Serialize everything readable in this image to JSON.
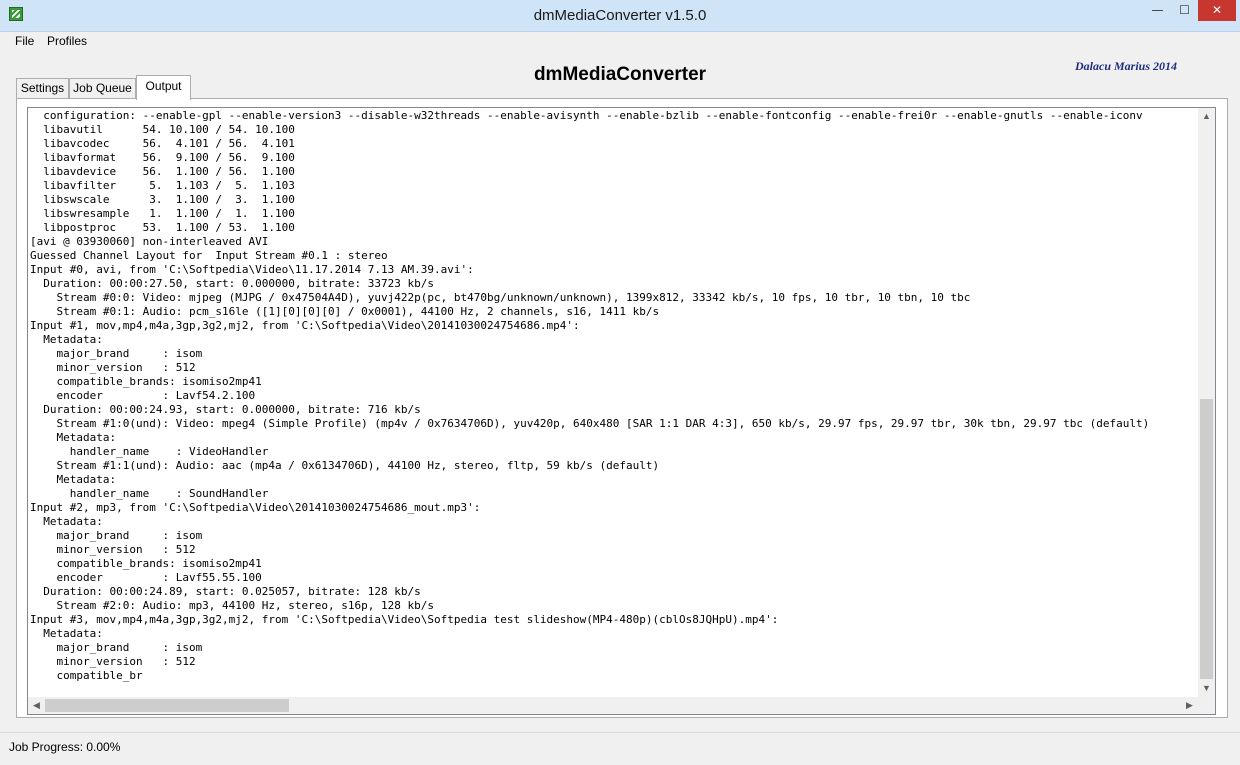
{
  "window": {
    "title": "dmMediaConverter v1.5.0",
    "minimize": "—",
    "maximize": "☐",
    "close": "✕"
  },
  "menu": {
    "file": "File",
    "profiles": "Profiles"
  },
  "header": {
    "app_name": "dmMediaConverter",
    "author": "Dalacu Marius 2014"
  },
  "tabs": {
    "settings": "Settings",
    "job_queue": "Job Queue",
    "output": "Output",
    "active": "Output"
  },
  "output_log": {
    "lines": [
      "  configuration: --enable-gpl --enable-version3 --disable-w32threads --enable-avisynth --enable-bzlib --enable-fontconfig --enable-frei0r --enable-gnutls --enable-iconv",
      "  libavutil      54. 10.100 / 54. 10.100",
      "  libavcodec     56.  4.101 / 56.  4.101",
      "  libavformat    56.  9.100 / 56.  9.100",
      "  libavdevice    56.  1.100 / 56.  1.100",
      "  libavfilter     5.  1.103 /  5.  1.103",
      "  libswscale      3.  1.100 /  3.  1.100",
      "  libswresample   1.  1.100 /  1.  1.100",
      "  libpostproc    53.  1.100 / 53.  1.100",
      "[avi @ 03930060] non-interleaved AVI",
      "Guessed Channel Layout for  Input Stream #0.1 : stereo",
      "Input #0, avi, from 'C:\\Softpedia\\Video\\11.17.2014 7.13 AM.39.avi':",
      "  Duration: 00:00:27.50, start: 0.000000, bitrate: 33723 kb/s",
      "    Stream #0:0: Video: mjpeg (MJPG / 0x47504A4D), yuvj422p(pc, bt470bg/unknown/unknown), 1399x812, 33342 kb/s, 10 fps, 10 tbr, 10 tbn, 10 tbc",
      "    Stream #0:1: Audio: pcm_s16le ([1][0][0][0] / 0x0001), 44100 Hz, 2 channels, s16, 1411 kb/s",
      "Input #1, mov,mp4,m4a,3gp,3g2,mj2, from 'C:\\Softpedia\\Video\\20141030024754686.mp4':",
      "  Metadata:",
      "    major_brand     : isom",
      "    minor_version   : 512",
      "    compatible_brands: isomiso2mp41",
      "    encoder         : Lavf54.2.100",
      "  Duration: 00:00:24.93, start: 0.000000, bitrate: 716 kb/s",
      "    Stream #1:0(und): Video: mpeg4 (Simple Profile) (mp4v / 0x7634706D), yuv420p, 640x480 [SAR 1:1 DAR 4:3], 650 kb/s, 29.97 fps, 29.97 tbr, 30k tbn, 29.97 tbc (default)",
      "    Metadata:",
      "      handler_name    : VideoHandler",
      "    Stream #1:1(und): Audio: aac (mp4a / 0x6134706D), 44100 Hz, stereo, fltp, 59 kb/s (default)",
      "    Metadata:",
      "      handler_name    : SoundHandler",
      "Input #2, mp3, from 'C:\\Softpedia\\Video\\20141030024754686_mout.mp3':",
      "  Metadata:",
      "    major_brand     : isom",
      "    minor_version   : 512",
      "    compatible_brands: isomiso2mp41",
      "    encoder         : Lavf55.55.100",
      "  Duration: 00:00:24.89, start: 0.025057, bitrate: 128 kb/s",
      "    Stream #2:0: Audio: mp3, 44100 Hz, stereo, s16p, 128 kb/s",
      "Input #3, mov,mp4,m4a,3gp,3g2,mj2, from 'C:\\Softpedia\\Video\\Softpedia test slideshow(MP4-480p)(cblOs8JQHpU).mp4':",
      "  Metadata:",
      "    major_brand     : isom",
      "    minor_version   : 512",
      "    compatible_br"
    ]
  },
  "scrollbars": {
    "up": "▲",
    "down": "▼",
    "left": "◀",
    "right": "▶"
  },
  "status": {
    "job_progress": "Job Progress: 0.00%"
  }
}
